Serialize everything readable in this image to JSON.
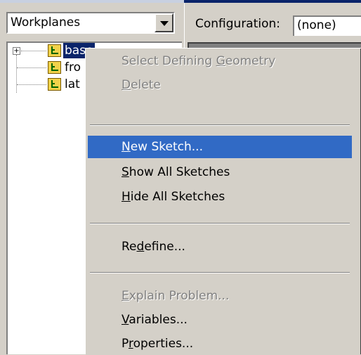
{
  "toolbar": {
    "workplanes_dropdown": "Workplanes",
    "configuration_label": "Configuration:",
    "configuration_value": "(none)"
  },
  "tree": {
    "items": [
      {
        "label": "base",
        "expandable": true,
        "selected": true
      },
      {
        "label": "fro",
        "expandable": false,
        "selected": false
      },
      {
        "label": "lat",
        "expandable": false,
        "selected": false
      }
    ]
  },
  "context_menu": {
    "items": [
      {
        "pre": "Select Defining ",
        "key": "G",
        "post": "eometry",
        "enabled": false
      },
      {
        "pre": "",
        "key": "D",
        "post": "elete",
        "enabled": false
      },
      {
        "pre": "",
        "key": "N",
        "post": "ew Sketch...",
        "enabled": true,
        "highlighted": true
      },
      {
        "pre": "",
        "key": "S",
        "post": "how All Sketches",
        "enabled": true
      },
      {
        "pre": "",
        "key": "H",
        "post": "ide All Sketches",
        "enabled": true
      },
      {
        "pre": "Re",
        "key": "d",
        "post": "efine...",
        "enabled": true
      },
      {
        "pre": "",
        "key": "E",
        "post": "xplain Problem...",
        "enabled": false
      },
      {
        "pre": "",
        "key": "V",
        "post": "ariables...",
        "enabled": true
      },
      {
        "pre": "P",
        "key": "r",
        "post": "operties...",
        "enabled": true
      }
    ]
  },
  "colors": {
    "highlight": "#316ac5",
    "selection": "#0a246a",
    "face": "#d4d0c8",
    "disabled_text": "#808080"
  }
}
